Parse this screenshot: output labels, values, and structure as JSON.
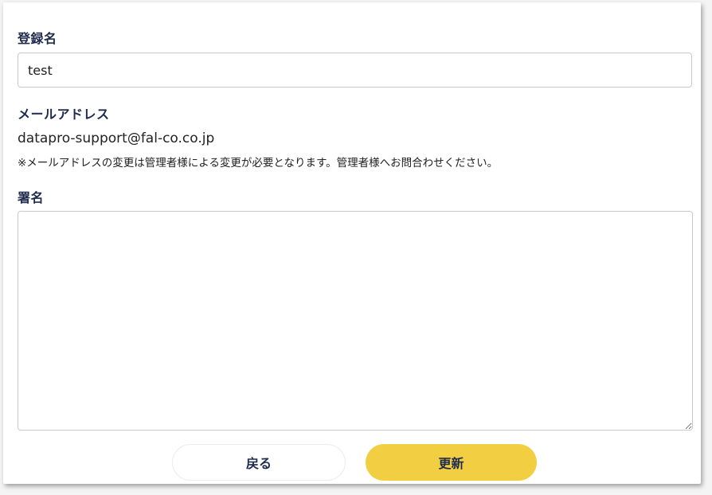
{
  "form": {
    "name_label": "登録名",
    "name_value": "test",
    "email_label": "メールアドレス",
    "email_value": "datapro-support@fal-co.co.jp",
    "email_note": "※メールアドレスの変更は管理者様による変更が必要となります。管理者様へお問合わせください。",
    "signature_label": "署名",
    "signature_value": ""
  },
  "actions": {
    "back_label": "戻る",
    "update_label": "更新"
  }
}
